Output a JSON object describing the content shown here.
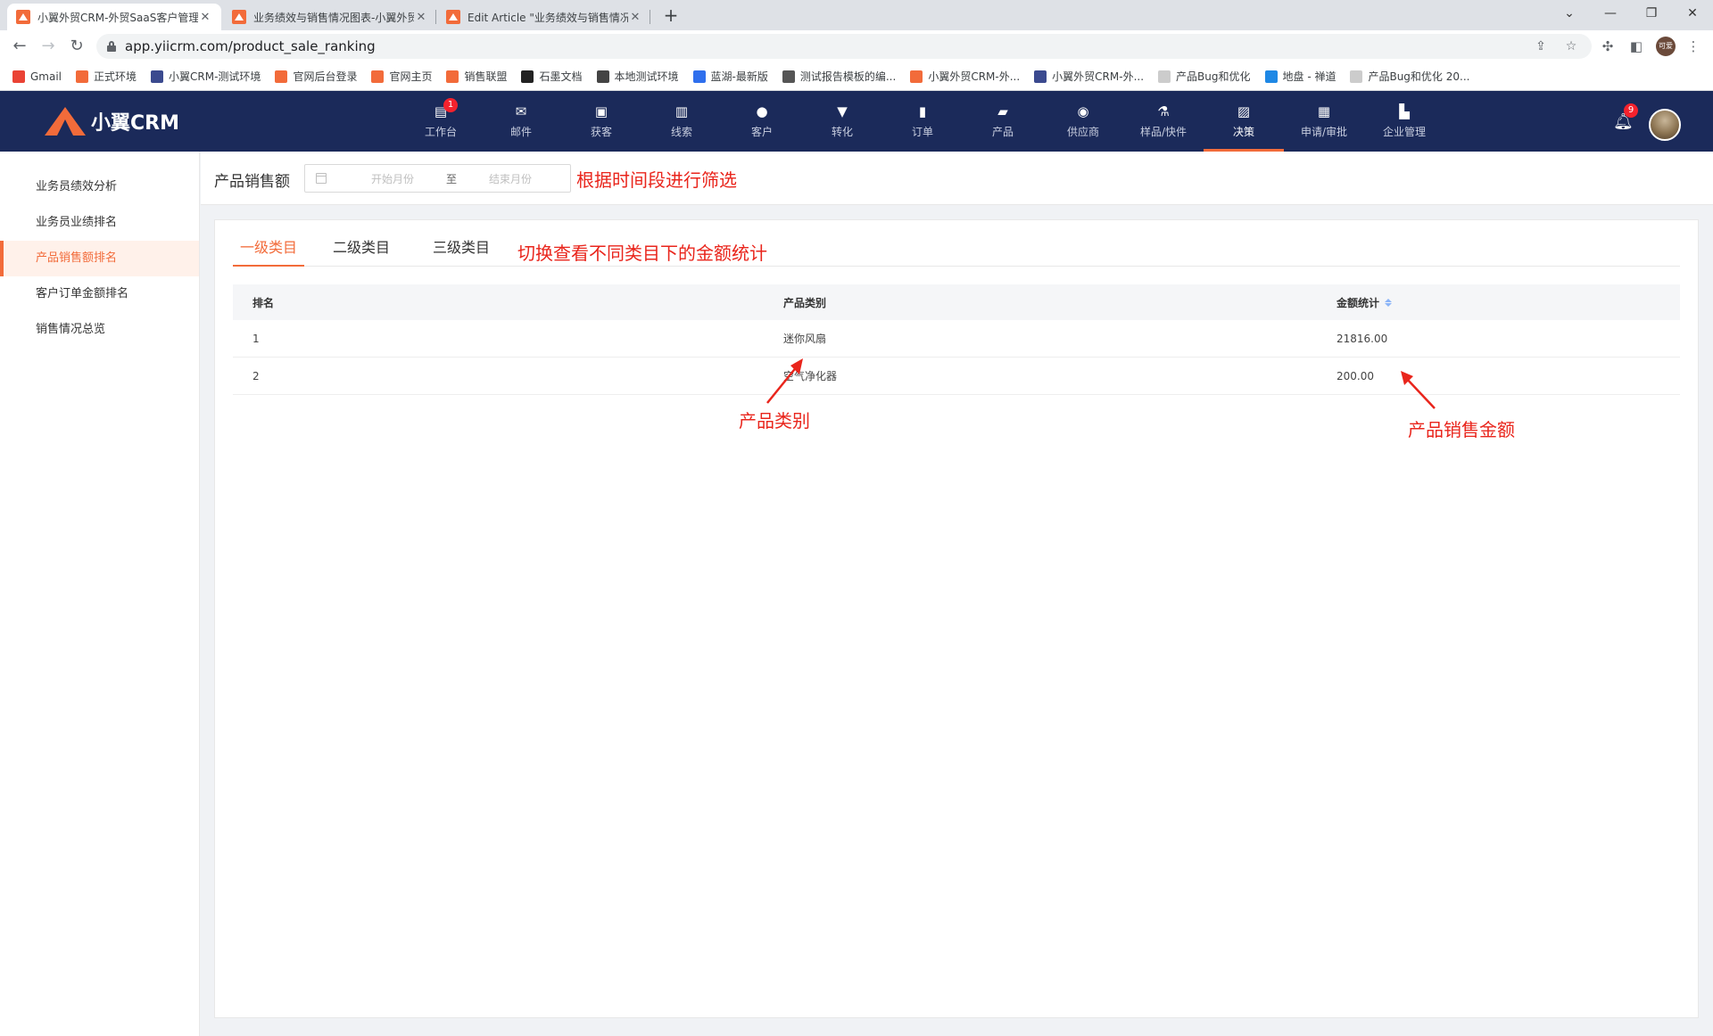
{
  "browser": {
    "tabs": [
      {
        "title": "小翼外贸CRM-外贸SaaS客户管理",
        "active": true
      },
      {
        "title": "业务绩效与销售情况图表-小翼外贸",
        "active": false
      },
      {
        "title": "Edit Article \"业务绩效与销售情况",
        "active": false
      }
    ],
    "new_tab": "+",
    "url": "app.yiicrm.com/product_sale_ranking",
    "profile_label": "可爱"
  },
  "bookmarks": [
    {
      "label": "Gmail",
      "color": "#ea4335"
    },
    {
      "label": "正式环境",
      "color": "#f26b3a"
    },
    {
      "label": "小翼CRM-测试环境",
      "color": "#3b4a8f"
    },
    {
      "label": "官网后台登录",
      "color": "#f26b3a"
    },
    {
      "label": "官网主页",
      "color": "#f26b3a"
    },
    {
      "label": "销售联盟",
      "color": "#f26b3a"
    },
    {
      "label": "石墨文档",
      "color": "#222222"
    },
    {
      "label": "本地测试环境",
      "color": "#444444"
    },
    {
      "label": "蓝湖-最新版",
      "color": "#2f6fed"
    },
    {
      "label": "测试报告模板的编...",
      "color": "#555555"
    },
    {
      "label": "小翼外贸CRM-外...",
      "color": "#f26b3a"
    },
    {
      "label": "小翼外贸CRM-外...",
      "color": "#3b4a8f"
    },
    {
      "label": "产品Bug和优化",
      "color": "#cccccc"
    },
    {
      "label": "地盘 - 禅道",
      "color": "#1e88e5"
    },
    {
      "label": "产品Bug和优化 20...",
      "color": "#cccccc"
    }
  ],
  "app": {
    "brand": "小翼CRM",
    "nav": [
      {
        "label": "工作台",
        "icon": "workbench-icon",
        "glyph": "▤",
        "badge": "1"
      },
      {
        "label": "邮件",
        "icon": "mail-icon",
        "glyph": "✉"
      },
      {
        "label": "获客",
        "icon": "acquire-icon",
        "glyph": "▣"
      },
      {
        "label": "线索",
        "icon": "leads-icon",
        "glyph": "▥"
      },
      {
        "label": "客户",
        "icon": "customer-icon",
        "glyph": "●"
      },
      {
        "label": "转化",
        "icon": "funnel-icon",
        "glyph": "▼"
      },
      {
        "label": "订单",
        "icon": "order-icon",
        "glyph": "▮"
      },
      {
        "label": "产品",
        "icon": "product-icon",
        "glyph": "▰"
      },
      {
        "label": "供应商",
        "icon": "supplier-icon",
        "glyph": "◉"
      },
      {
        "label": "样品/快件",
        "icon": "sample-icon",
        "glyph": "⚗"
      },
      {
        "label": "决策",
        "icon": "decision-icon",
        "glyph": "▨",
        "active": true
      },
      {
        "label": "申请/审批",
        "icon": "approval-icon",
        "glyph": "▦"
      },
      {
        "label": "企业管理",
        "icon": "enterprise-icon",
        "glyph": "▙"
      }
    ],
    "notification_badge": "9"
  },
  "sidebar": {
    "items": [
      {
        "label": "业务员绩效分析"
      },
      {
        "label": "业务员业绩排名"
      },
      {
        "label": "产品销售额排名",
        "active": true
      },
      {
        "label": "客户订单金额排名"
      },
      {
        "label": "销售情况总览"
      }
    ]
  },
  "filter": {
    "title": "产品销售额",
    "start_placeholder": "开始月份",
    "separator": "至",
    "end_placeholder": "结束月份"
  },
  "annotations": {
    "time_filter": "根据时间段进行筛选",
    "category_switch": "切换查看不同类目下的金额统计",
    "category_column": "产品类别",
    "amount_column": "产品销售金额",
    "color": "#e9251c"
  },
  "category_tabs": [
    {
      "label": "一级类目",
      "active": true
    },
    {
      "label": "二级类目"
    },
    {
      "label": "三级类目"
    }
  ],
  "table": {
    "columns": [
      "排名",
      "产品类别",
      "金额统计"
    ],
    "rows": [
      {
        "rank": "1",
        "category": "迷你风扇",
        "amount": "21816.00"
      },
      {
        "rank": "2",
        "category": "空气净化器",
        "amount": "200.00"
      }
    ]
  },
  "accent_color": "#f26b3a",
  "header_color": "#1b2a5a"
}
